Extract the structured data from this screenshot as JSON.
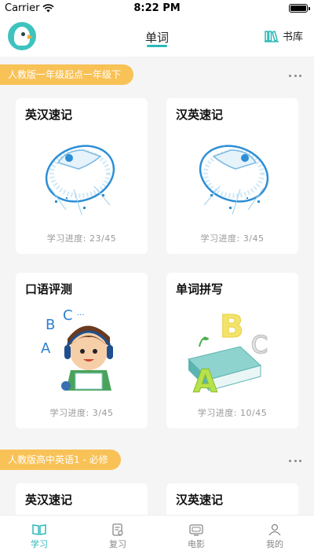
{
  "status_bar": {
    "carrier": "Carrier",
    "time": "8:22 PM"
  },
  "header": {
    "tab_label": "单词",
    "library_label": "书库"
  },
  "sections": [
    {
      "label": "人教版一年级起点一年级下",
      "cards": [
        {
          "title": "英汉速记",
          "progress": "学习进度: 23/45",
          "icon": "rocket-illustration"
        },
        {
          "title": "汉英速记",
          "progress": "学习进度: 3/45",
          "icon": "rocket-illustration"
        },
        {
          "title": "口语评测",
          "progress": "学习进度: 3/45",
          "icon": "boy-headphones-illustration"
        },
        {
          "title": "单词拼写",
          "progress": "学习进度: 10/45",
          "icon": "abc-book-illustration"
        }
      ]
    },
    {
      "label": "人教版高中英语1 - 必修",
      "cards": [
        {
          "title": "英汉速记"
        },
        {
          "title": "汉英速记"
        }
      ]
    }
  ],
  "tabbar": [
    {
      "label": "学习",
      "icon": "book-icon",
      "active": true
    },
    {
      "label": "复习",
      "icon": "notes-icon",
      "active": false
    },
    {
      "label": "电影",
      "icon": "tv-icon",
      "active": false
    },
    {
      "label": "我的",
      "icon": "person-icon",
      "active": false
    }
  ],
  "colors": {
    "accent": "#2cb9b9",
    "pill": "#f8c257",
    "background": "#f5f5f5"
  }
}
